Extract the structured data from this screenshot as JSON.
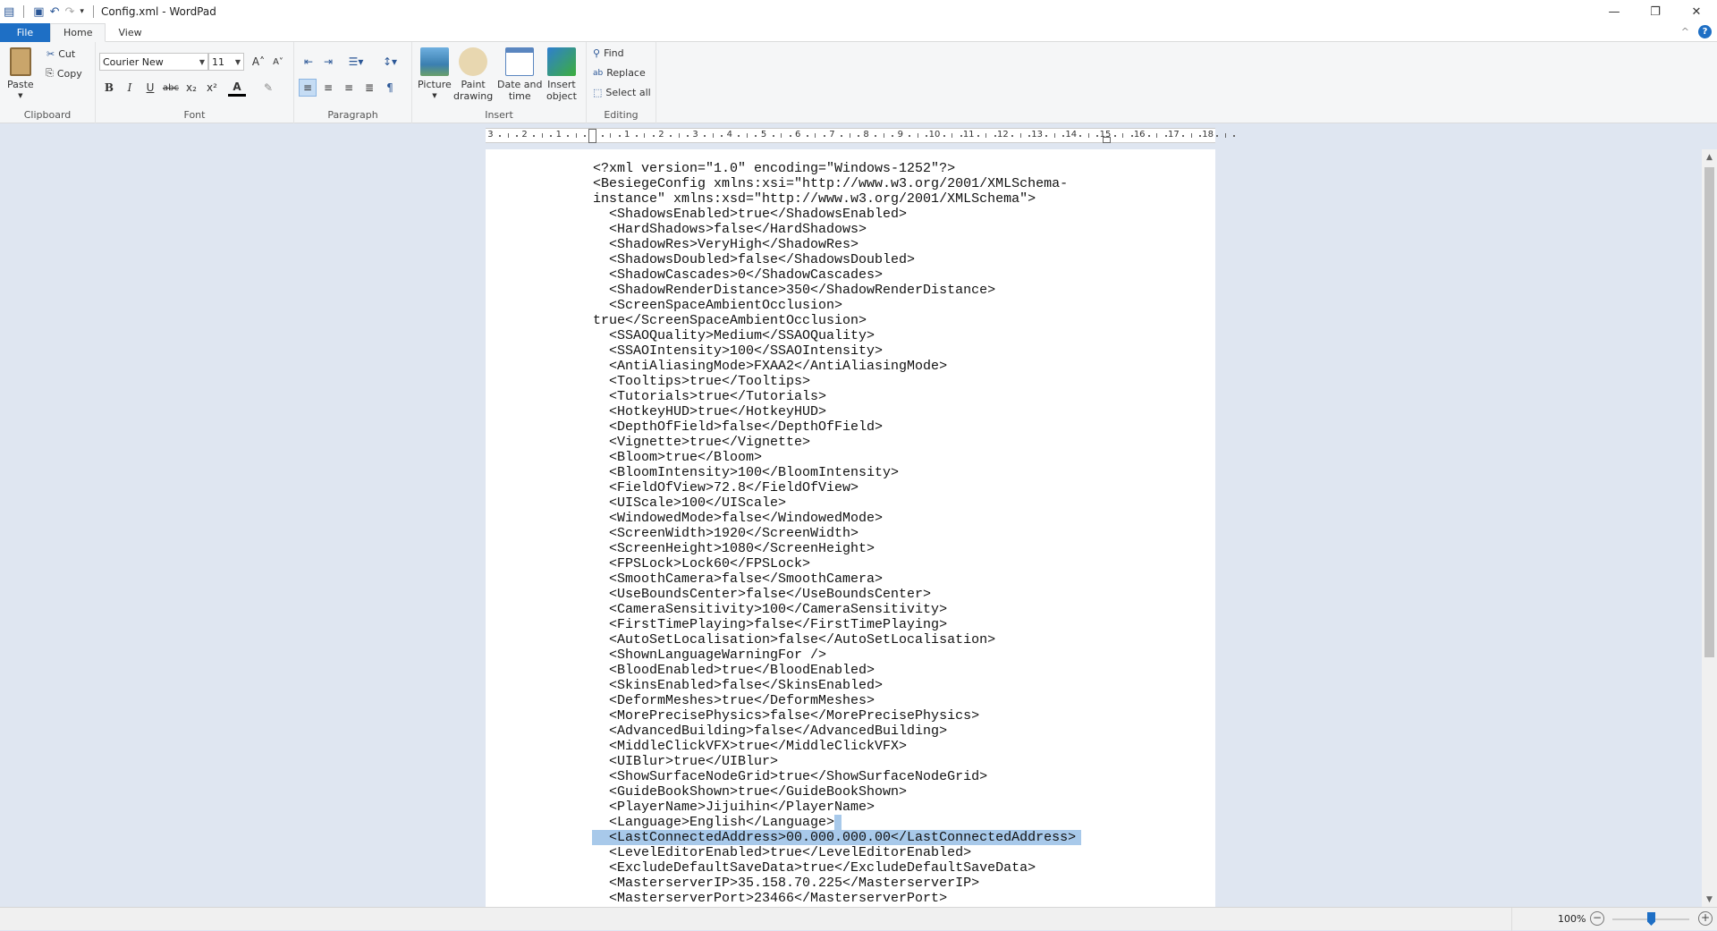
{
  "window": {
    "title": "Config.xml - WordPad",
    "minimize": "—",
    "restore": "❐",
    "close": "✕"
  },
  "tabs": {
    "file": "File",
    "home": "Home",
    "view": "View",
    "collapse": "^",
    "help": "?"
  },
  "ribbon": {
    "clipboard": {
      "label": "Clipboard",
      "paste": "Paste",
      "cut": "Cut",
      "copy": "Copy"
    },
    "font": {
      "label": "Font",
      "family": "Courier New",
      "size": "11",
      "bold": "B",
      "italic": "I",
      "underline": "U",
      "strike": "abc",
      "sub": "x₂",
      "sup": "x²",
      "grow": "A˄",
      "shrink": "A˅",
      "color": "A",
      "highlight": "✎"
    },
    "paragraph": {
      "label": "Paragraph"
    },
    "insert": {
      "label": "Insert",
      "picture": "Picture",
      "paint1": "Paint",
      "paint2": "drawing",
      "date1": "Date and",
      "date2": "time",
      "obj1": "Insert",
      "obj2": "object"
    },
    "editing": {
      "label": "Editing",
      "find": "Find",
      "replace": "Replace",
      "select_all": "Select all"
    }
  },
  "ruler": {
    "labels": [
      "3",
      "2",
      "1",
      "",
      "1",
      "2",
      "3",
      "4",
      "5",
      "6",
      "7",
      "8",
      "9",
      "10",
      "11",
      "12",
      "13",
      "14",
      "15",
      "16",
      "17",
      "18"
    ]
  },
  "doc": {
    "selected_line": 44,
    "lines": [
      "<?xml version=\"1.0\" encoding=\"Windows-1252\"?>",
      "<BesiegeConfig xmlns:xsi=\"http://www.w3.org/2001/XMLSchema-",
      "instance\" xmlns:xsd=\"http://www.w3.org/2001/XMLSchema\">",
      "  <ShadowsEnabled>true</ShadowsEnabled>",
      "  <HardShadows>false</HardShadows>",
      "  <ShadowRes>VeryHigh</ShadowRes>",
      "  <ShadowsDoubled>false</ShadowsDoubled>",
      "  <ShadowCascades>0</ShadowCascades>",
      "  <ShadowRenderDistance>350</ShadowRenderDistance>",
      "  <ScreenSpaceAmbientOcclusion>",
      "true</ScreenSpaceAmbientOcclusion>",
      "  <SSAOQuality>Medium</SSAOQuality>",
      "  <SSAOIntensity>100</SSAOIntensity>",
      "  <AntiAliasingMode>FXAA2</AntiAliasingMode>",
      "  <Tooltips>true</Tooltips>",
      "  <Tutorials>true</Tutorials>",
      "  <HotkeyHUD>true</HotkeyHUD>",
      "  <DepthOfField>false</DepthOfField>",
      "  <Vignette>true</Vignette>",
      "  <Bloom>true</Bloom>",
      "  <BloomIntensity>100</BloomIntensity>",
      "  <FieldOfView>72.8</FieldOfView>",
      "  <UIScale>100</UIScale>",
      "  <WindowedMode>false</WindowedMode>",
      "  <ScreenWidth>1920</ScreenWidth>",
      "  <ScreenHeight>1080</ScreenHeight>",
      "  <FPSLock>Lock60</FPSLock>",
      "  <SmoothCamera>false</SmoothCamera>",
      "  <UseBoundsCenter>false</UseBoundsCenter>",
      "  <CameraSensitivity>100</CameraSensitivity>",
      "  <FirstTimePlaying>false</FirstTimePlaying>",
      "  <AutoSetLocalisation>false</AutoSetLocalisation>",
      "  <ShownLanguageWarningFor />",
      "  <BloodEnabled>true</BloodEnabled>",
      "  <SkinsEnabled>false</SkinsEnabled>",
      "  <DeformMeshes>true</DeformMeshes>",
      "  <MorePrecisePhysics>false</MorePrecisePhysics>",
      "  <AdvancedBuilding>false</AdvancedBuilding>",
      "  <MiddleClickVFX>true</MiddleClickVFX>",
      "  <UIBlur>true</UIBlur>",
      "  <ShowSurfaceNodeGrid>true</ShowSurfaceNodeGrid>",
      "  <GuideBookShown>true</GuideBookShown>",
      "  <PlayerName>Jijuihin</PlayerName>",
      "  <Language>English</Language>",
      "  <LastConnectedAddress>00.000.000.00</LastConnectedAddress>",
      "  <LevelEditorEnabled>true</LevelEditorEnabled>",
      "  <ExcludeDefaultSaveData>true</ExcludeDefaultSaveData>",
      "  <MasterserverIP>35.158.70.225</MasterserverIP>",
      "  <MasterserverPort>23466</MasterserverPort>"
    ]
  },
  "status": {
    "zoom": "100%",
    "zoom_out": "−",
    "zoom_in": "+",
    "zoom_level_percent": 100
  }
}
